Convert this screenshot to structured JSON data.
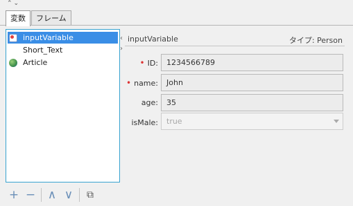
{
  "header": {
    "chevron_up": "⌃",
    "chevron_down": "⌄"
  },
  "tabs": [
    {
      "label": "変数",
      "active": true
    },
    {
      "label": "フレーム",
      "active": false
    }
  ],
  "tree": {
    "items": [
      {
        "label": "inputVariable",
        "icon": "variable-icon",
        "selected": true
      },
      {
        "label": "Short_Text",
        "icon": "",
        "selected": false
      },
      {
        "label": "Article",
        "icon": "globe-icon",
        "selected": false
      }
    ]
  },
  "toolbar": {
    "add": "+",
    "remove": "−",
    "move_up": "∧",
    "move_down": "∨",
    "open": "⧉"
  },
  "splitter": {
    "collapse_left": "‹",
    "expand_right": "›"
  },
  "detail": {
    "title": "inputVariable",
    "type_label": "タイプ: Person",
    "fields": [
      {
        "label": "ID:",
        "value": "1234566789",
        "required": true,
        "disabled": false
      },
      {
        "label": "name:",
        "value": "John",
        "required": true,
        "disabled": false
      },
      {
        "label": "age:",
        "value": "35",
        "required": false,
        "disabled": false
      },
      {
        "label": "isMale:",
        "value": "true",
        "required": false,
        "disabled": true,
        "dropdown": true
      }
    ]
  },
  "colors": {
    "selection": "#3a8ee6",
    "tree_border": "#38a3d0",
    "required_marker": "#d33333"
  }
}
